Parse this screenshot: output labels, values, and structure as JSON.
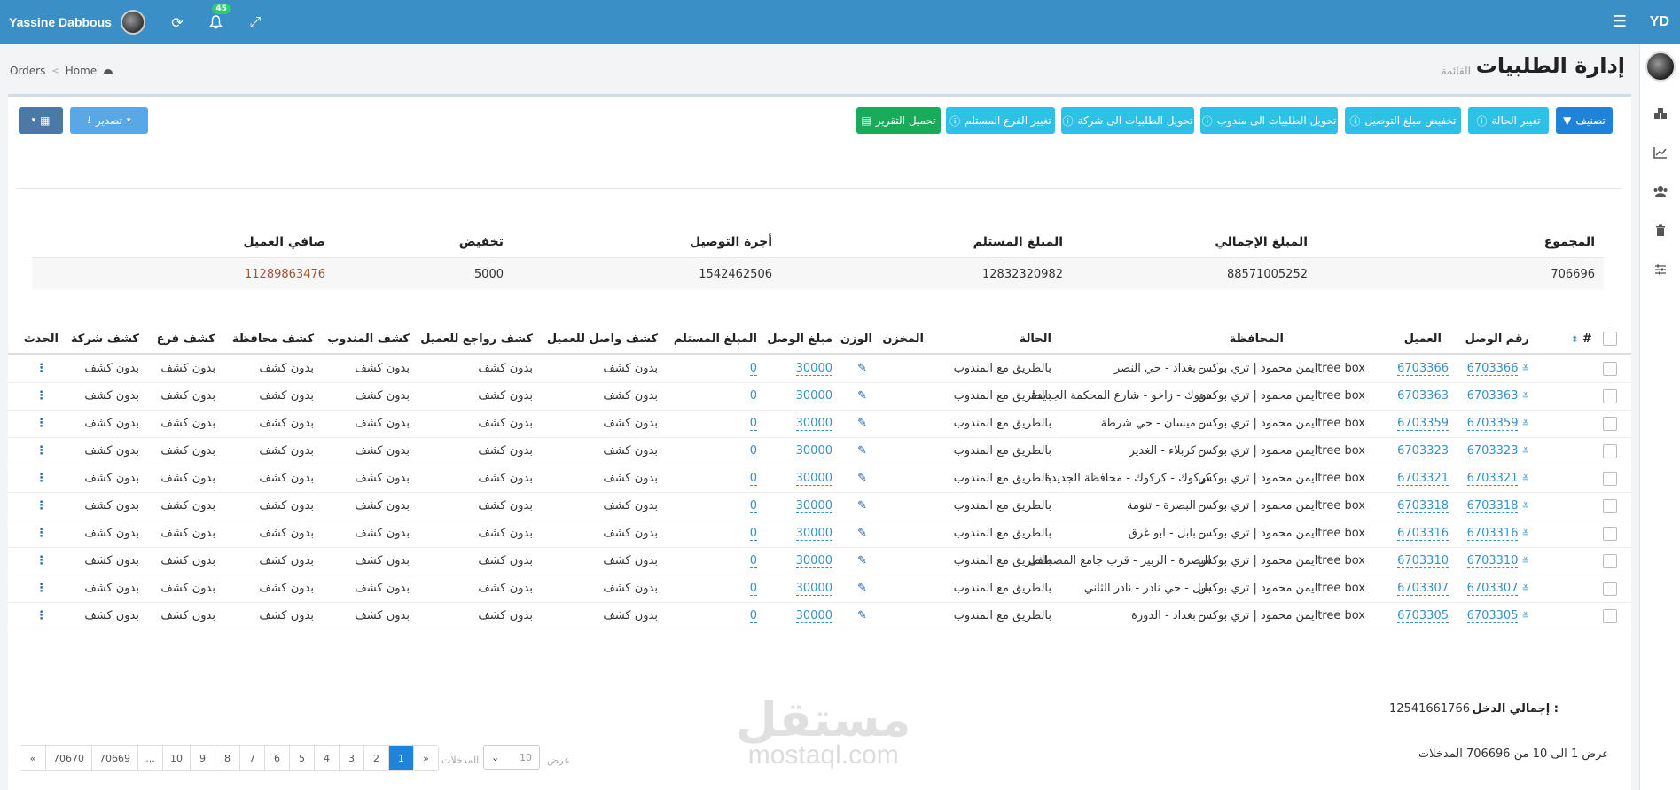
{
  "topbar": {
    "user_name": "Yassine Dabbous",
    "notif_count": "45",
    "brand": "YD"
  },
  "header": {
    "title": "إدارة الطلبيات",
    "subtitle": "القائمة",
    "breadcrumb": [
      "Orders",
      "Home"
    ]
  },
  "toolbar": {
    "classify": "تصنيف",
    "change_status": "تغيير الحالة",
    "reduce_delivery": "تخفيض مبلغ التوصيل",
    "to_delegate": "تحويل الطلبيات الى مندوب",
    "to_company": "تحويل الطلبيات الى شركة",
    "change_branch": "تغيير الفرع المستلم",
    "download_report": "تحميل التقرير",
    "export": "تصدير"
  },
  "summary": {
    "headers": [
      "المجموع",
      "المبلغ الإجمالي",
      "المبلغ المستلم",
      "أجرة التوصيل",
      "تخفيض",
      "صافي العميل"
    ],
    "values": [
      "706696",
      "88571005252",
      "12832320982",
      "1542462506",
      "5000",
      "11289863476"
    ]
  },
  "table": {
    "headers": {
      "num": "#",
      "receipt": "رقم الوصل",
      "client": "العميل",
      "province": "المحافظة",
      "status": "الحالة",
      "warehouse": "المخزن",
      "weight": "الوزن",
      "receipt_amount": "مبلغ الوصل",
      "received_amount": "المبلغ المستلم",
      "client_receipt": "كشف واصل للعميل",
      "client_returns": "كشف رواجع للعميل",
      "delegate": "كشف المندوب",
      "province_stmt": "كشف محافظة",
      "branch": "كشف فرع",
      "company": "كشف شركة",
      "event": "الحدث"
    },
    "rows": [
      {
        "id": "6703366",
        "receipt": "6703366",
        "client": "ايمن محمود | تري بوكسtree box",
        "province": "بغداد - حي النصر - .",
        "status": "بالطريق مع المندوب",
        "amount": "30000",
        "received": "0",
        "stmt": "بدون كشف"
      },
      {
        "id": "6703363",
        "receipt": "6703363",
        "client": "ايمن محمود | تري بوكسtree box",
        "province": "دهوك - زاخو - شارع المحكمة الجديدة",
        "status": "بالطريق مع المندوب",
        "amount": "30000",
        "received": "0",
        "stmt": "بدون كشف"
      },
      {
        "id": "6703359",
        "receipt": "6703359",
        "client": "ايمن محمود | تري بوكسtree box",
        "province": "ميسان - حي شرطة - .",
        "status": "بالطريق مع المندوب",
        "amount": "30000",
        "received": "0",
        "stmt": "بدون كشف"
      },
      {
        "id": "6703323",
        "receipt": "6703323",
        "client": "ايمن محمود | تري بوكسtree box",
        "province": "كربلاء - الغدير - .",
        "status": "بالطريق مع المندوب",
        "amount": "30000",
        "received": "0",
        "stmt": "بدون كشف"
      },
      {
        "id": "6703321",
        "receipt": "6703321",
        "client": "ايمن محمود | تري بوكسtree box",
        "province": "كركوك - كركوك - محافظة الجديدة",
        "status": "بالطريق مع المندوب",
        "amount": "30000",
        "received": "0",
        "stmt": "بدون كشف"
      },
      {
        "id": "6703318",
        "receipt": "6703318",
        "client": "ايمن محمود | تري بوكسtree box",
        "province": "البصرة - تنومة - .",
        "status": "بالطريق مع المندوب",
        "amount": "30000",
        "received": "0",
        "stmt": "بدون كشف"
      },
      {
        "id": "6703316",
        "receipt": "6703316",
        "client": "ايمن محمود | تري بوكسtree box",
        "province": "بابل - ابو غرق - .",
        "status": "بالطريق مع المندوب",
        "amount": "30000",
        "received": "0",
        "stmt": "بدون كشف"
      },
      {
        "id": "6703310",
        "receipt": "6703310",
        "client": "ايمن محمود | تري بوكسtree box",
        "province": "البصرة - الزبير - قرب جامع المصطفى",
        "status": "بالطريق مع المندوب",
        "amount": "30000",
        "received": "0",
        "stmt": "بدون كشف"
      },
      {
        "id": "6703307",
        "receipt": "6703307",
        "client": "ايمن محمود | تري بوكسtree box",
        "province": "بابل - حي نادر - نادر الثاني",
        "status": "بالطريق مع المندوب",
        "amount": "30000",
        "received": "0",
        "stmt": "بدون كشف"
      },
      {
        "id": "6703305",
        "receipt": "6703305",
        "client": "ايمن محمود | تري بوكسtree box",
        "province": "بغداد - الدورة - .",
        "status": "بالطريق مع المندوب",
        "amount": "30000",
        "received": "0",
        "stmt": "بدون كشف"
      }
    ]
  },
  "totals": {
    "income_label": "إجمالي الدخل :",
    "income_value": "12541661766"
  },
  "pagination": {
    "pages": [
      "«",
      "70670",
      "70669",
      "...",
      "10",
      "9",
      "8",
      "7",
      "6",
      "5",
      "4",
      "3",
      "2",
      "1",
      "»"
    ],
    "active": "1",
    "per_page": "10",
    "show_label": "عرض",
    "entries_label": "المدخلات",
    "showing_text": "عرض 1 الى 10 من 706696 المدخلات"
  },
  "watermark": {
    "arabic": "مستقل",
    "latin": "mostaql.com"
  },
  "colors": {
    "topbar": "#3a8fc7",
    "primary": "#2083d8",
    "cyan": "#2fc0e6",
    "green": "#1aab5a",
    "brown": "#a0522d"
  }
}
